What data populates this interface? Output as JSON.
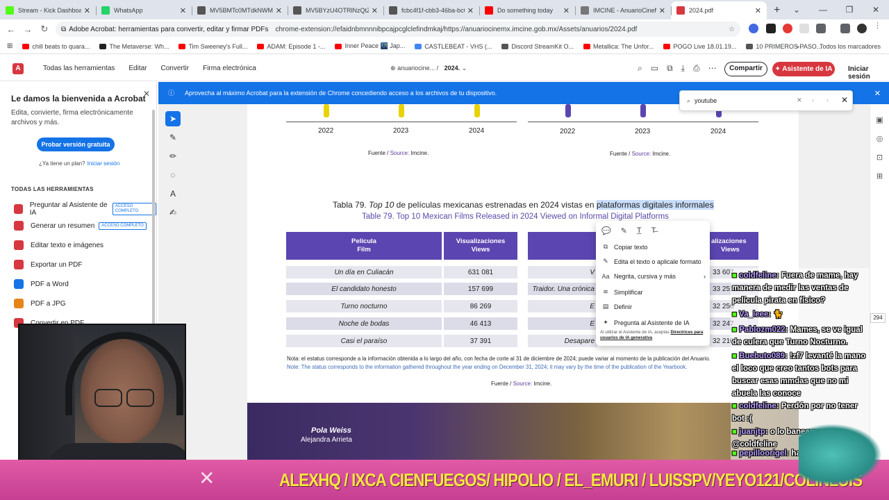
{
  "browser": {
    "tabs": [
      {
        "title": "Stream - Kick Dashboard",
        "color": "#53fc18"
      },
      {
        "title": "WhatsApp",
        "color": "#25d366"
      },
      {
        "title": "MV5BMTc0MTdkNWMtM",
        "color": "#555555"
      },
      {
        "title": "MV5BYzU4OTRlNzQtZjI0...",
        "color": "#555555"
      },
      {
        "title": "fcbc4f1f-cbb3-46ba-bc6...",
        "color": "#555555"
      },
      {
        "title": "Do something today",
        "color": "#ff0000"
      },
      {
        "title": "IMCINE - AnuarioCineMx",
        "color": "#777777"
      },
      {
        "title": "2024.pdf",
        "color": "#d7373f"
      }
    ],
    "site_label": "Adobe Acrobat: herramientas para convertir, editar y firmar PDFs",
    "url": "chrome-extension://efaidnbmnnnibpcajpcglclefindmkaj/https://anuariocinemx.imcine.gob.mx/Assets/anuarios/2024.pdf",
    "bookmarks": [
      {
        "label": "chill beats to quara...",
        "color": "#ff0000"
      },
      {
        "label": "The Metaverse: Wh...",
        "color": "#222222"
      },
      {
        "label": "Tim Sweeney's Full...",
        "color": "#ff0000"
      },
      {
        "label": "ADAM: Episode 1 -...",
        "color": "#ff0000"
      },
      {
        "label": "Inner Peace 🌃 Jap...",
        "color": "#ff0000"
      },
      {
        "label": "CASTLEBEAT - VHS (...",
        "color": "#4285f4"
      },
      {
        "label": "Discord StreamKit O...",
        "color": "#555555"
      },
      {
        "label": "Metallica: The Unfor...",
        "color": "#ff0000"
      },
      {
        "label": "POGO Live 18.01.19...",
        "color": "#ff0000"
      },
      {
        "label": "10 PRIMEROS PASO...",
        "color": "#555555"
      }
    ],
    "bookmarks_all": "Todos los marcadores"
  },
  "acrobat": {
    "menu": [
      "Todas las herramientas",
      "Editar",
      "Convertir",
      "Firma electrónica"
    ],
    "doc_domain": "anuariocine...",
    "doc_name": "2024.",
    "share": "Compartir",
    "ai_assistant": "Asistente de IA",
    "signin": "Iniciar sesión",
    "banner": "Aprovecha al máximo Acrobat para la extensión de Chrome concediendo acceso a los archivos de tu dispositivo.",
    "search_value": "youtube",
    "page_number": "294"
  },
  "left_panel": {
    "title": "Le damos la bienvenida a Acrobat",
    "description": "Edita, convierte, firma electrónicamente archivos y más.",
    "try_button": "Probar versión gratuita",
    "plan_q": "¿Ya tiene un plan?",
    "plan_link": "Iniciar sesión",
    "section": "TODAS LAS HERRAMIENTAS",
    "tools": [
      {
        "label": "Preguntar al Asistente de IA",
        "badge": "ACCESO COMPLETO",
        "color": "#d7373f"
      },
      {
        "label": "Generar un resumen",
        "badge": "ACCESO COMPLETO",
        "color": "#d7373f"
      },
      {
        "label": "Editar texto e imágenes",
        "badge": "",
        "color": "#d7373f"
      },
      {
        "label": "Exportar un PDF",
        "badge": "",
        "color": "#d7373f"
      },
      {
        "label": "PDF a Word",
        "badge": "",
        "color": "#1473e6"
      },
      {
        "label": "PDF a JPG",
        "badge": "",
        "color": "#e68619"
      },
      {
        "label": "Convertir en PDF",
        "badge": "",
        "color": "#d7373f"
      }
    ]
  },
  "document": {
    "years_left": [
      "2022",
      "2023",
      "2024"
    ],
    "years_right": [
      "2022",
      "2023",
      "2024"
    ],
    "source_es": "Fuente /",
    "source_en": "Source:",
    "source_org": "Imcine.",
    "title_es_prefix": "Tabla 79.",
    "title_es_top": "Top 10",
    "title_es_mid": "de películas mexicanas estrenadas en 2024 vistas en",
    "title_es_hl": "plataformas digitales informales",
    "title_en": "Table 79. Top 10 Mexican Films Released in 2024 Viewed on Informal Digital Platforms",
    "header_film": "Película",
    "header_film_en": "Film",
    "header_views": "Visualizaciones",
    "header_views_en": "Views",
    "header_right_partial": "alizaciones",
    "header_right_partial_en": "Views",
    "rows_left": [
      {
        "film": "Un día en Culiacán",
        "views": "631 081"
      },
      {
        "film": "El candidato honesto",
        "views": "157 699"
      },
      {
        "film": "Turno nocturno",
        "views": "86 269"
      },
      {
        "film": "Noche de bodas",
        "views": "46 413"
      },
      {
        "film": "Casi el paraíso",
        "views": "37 391"
      }
    ],
    "rows_right_partial": [
      {
        "film": "V",
        "views": "33 607"
      },
      {
        "film": "Traidor. Una crónica",
        "views": "33 251"
      },
      {
        "film": "E",
        "views": "32 256"
      },
      {
        "film": "E",
        "views": "32 247"
      },
      {
        "film": "Desapare",
        "views": "32 210"
      }
    ],
    "note_es": "Nota: el estatus corresponde a la información obtenida a lo largo del año, con fecha de corte al 31 de diciembre de 2024; puede variar al momento de la publicación del Anuario.",
    "note_en": "Note: The status corresponds to the information gathered throughout the year ending on December 31, 2024; it may vary by the time of the publication of the Yearbook.",
    "poster_name1": "Pola Weiss",
    "poster_name2": "Alejandra Arrieta"
  },
  "context_menu": {
    "items": [
      "Copiar texto",
      "Edita el texto o aplicale formato",
      "Negrita, cursiva y más",
      "Simplificar",
      "Definir",
      "Pregunta al Asistente de IA"
    ],
    "legal_prefix": "Al utilizar el Asistente de IA, aceptas",
    "legal_link": "Directrices para usuarios de IA generativa"
  },
  "chat": [
    {
      "user": "coldfeline",
      "text": ": Fuera de mame, hay manera de medir las ventas de película pirata en físico?"
    },
    {
      "user": "Va_leee",
      "text": ": 🐈"
    },
    {
      "user": "Pablozm022",
      "text": ": Mames, se ve igual de culera que Turno Nocturno."
    },
    {
      "user": "Buebuto089",
      "text": ": !zf7 levanté la mano el loco que creo tantos bots para buscar esas mmdas que no mi abuela las conoce"
    },
    {
      "user": "coldfeline",
      "text": ": Perdón por no tener bot :("
    },
    {
      "user": "juanjtp",
      "text": ": o lo baneamos a @coldfeline"
    },
    {
      "user": "pepilloorigel",
      "text": ": ha de estar culera... como vivir ahí"
    }
  ],
  "ticker": "ALEXHQ / IXCA CIENFUEGOS/ HIPOLIO / EL_EMURI / LUISSPV/YEYO121/COLINLUIS"
}
